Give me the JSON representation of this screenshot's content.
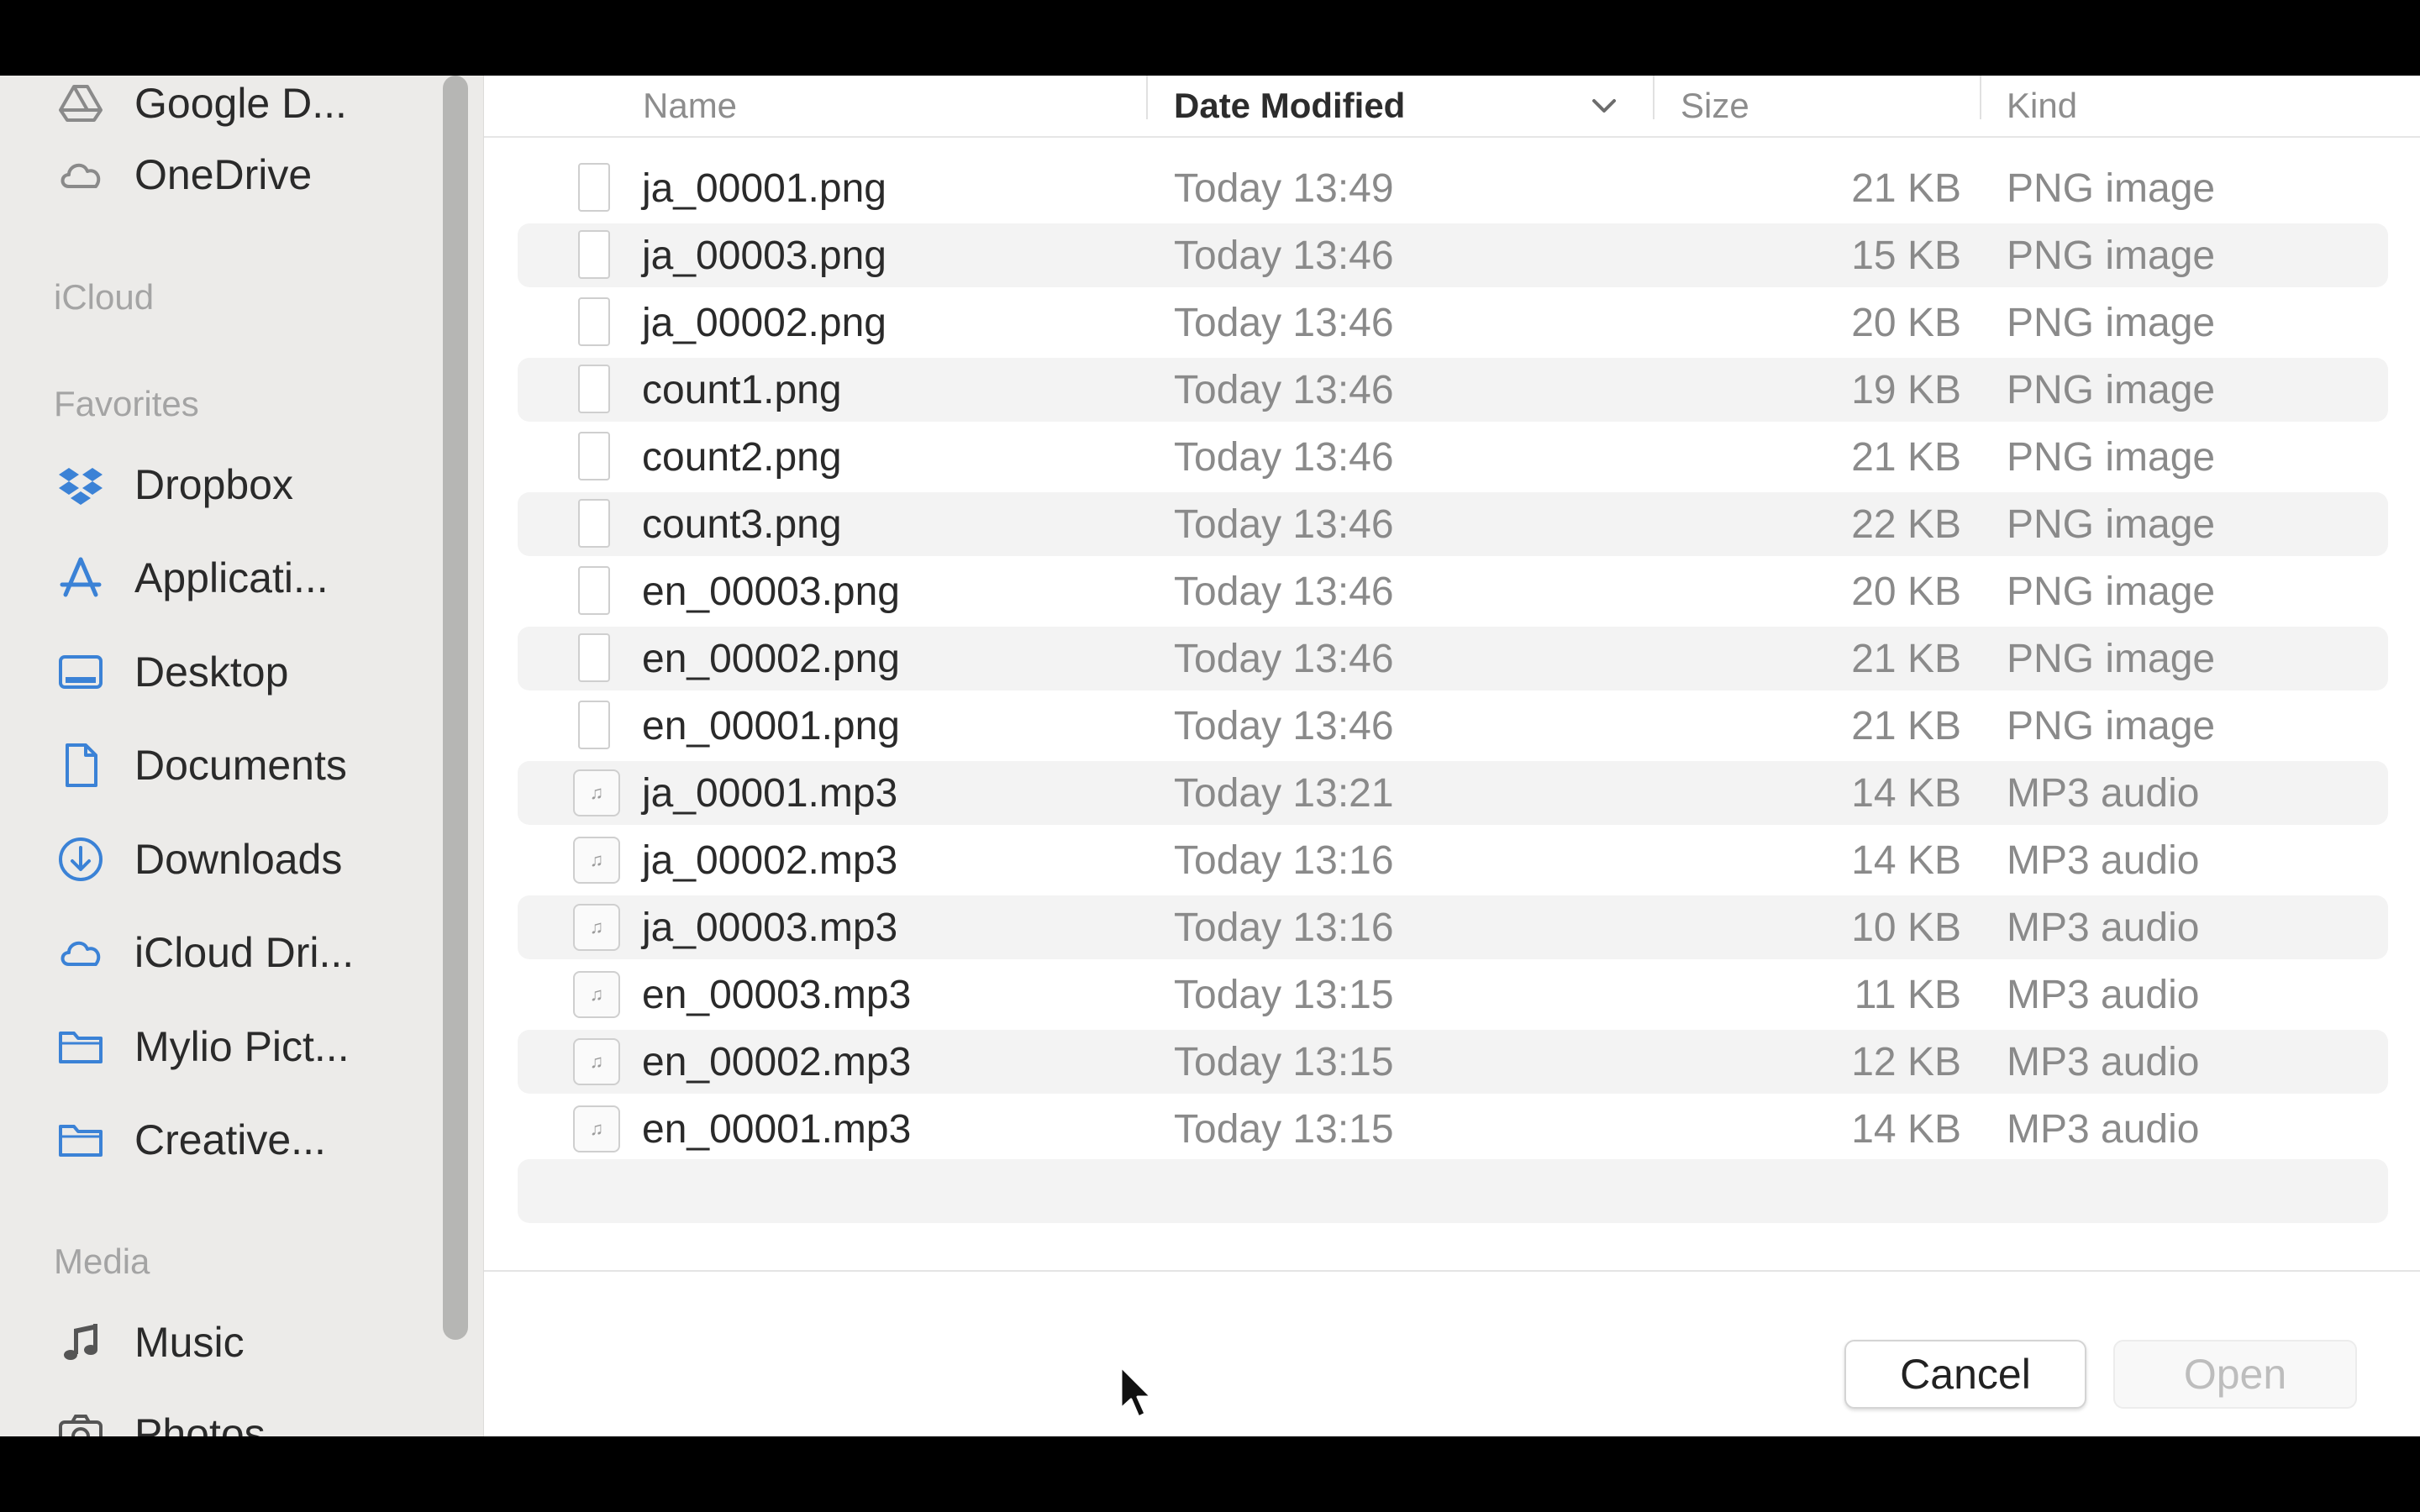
{
  "sidebar": {
    "top_items": [
      {
        "label": "Google D...",
        "icon": "google-drive-icon"
      },
      {
        "label": "OneDrive",
        "icon": "cloud-icon"
      }
    ],
    "sections": [
      {
        "label": "iCloud"
      },
      {
        "label": "Favorites"
      },
      {
        "label": "Media"
      }
    ],
    "favorites": [
      {
        "label": "Dropbox",
        "icon": "dropbox-icon"
      },
      {
        "label": "Applicati...",
        "icon": "applications-icon"
      },
      {
        "label": "Desktop",
        "icon": "desktop-icon"
      },
      {
        "label": "Documents",
        "icon": "document-icon"
      },
      {
        "label": "Downloads",
        "icon": "download-icon"
      },
      {
        "label": "iCloud Dri...",
        "icon": "cloud-icon"
      },
      {
        "label": "Mylio Pict...",
        "icon": "folder-icon"
      },
      {
        "label": "Creative...",
        "icon": "folder-icon"
      }
    ],
    "media": [
      {
        "label": "Music",
        "icon": "music-icon"
      },
      {
        "label": "Photos",
        "icon": "camera-icon"
      }
    ],
    "accent_color": "#3b82d6"
  },
  "header": {
    "name": "Name",
    "date_modified": "Date Modified",
    "size": "Size",
    "kind": "Kind"
  },
  "files": [
    {
      "name": "ja_00001.png",
      "date": "Today 13:49",
      "size": "21 KB",
      "kind": "PNG image",
      "type": "image"
    },
    {
      "name": "ja_00003.png",
      "date": "Today 13:46",
      "size": "15 KB",
      "kind": "PNG image",
      "type": "image"
    },
    {
      "name": "ja_00002.png",
      "date": "Today 13:46",
      "size": "20 KB",
      "kind": "PNG image",
      "type": "image"
    },
    {
      "name": "count1.png",
      "date": "Today 13:46",
      "size": "19 KB",
      "kind": "PNG image",
      "type": "image"
    },
    {
      "name": "count2.png",
      "date": "Today 13:46",
      "size": "21 KB",
      "kind": "PNG image",
      "type": "image"
    },
    {
      "name": "count3.png",
      "date": "Today 13:46",
      "size": "22 KB",
      "kind": "PNG image",
      "type": "image"
    },
    {
      "name": "en_00003.png",
      "date": "Today 13:46",
      "size": "20 KB",
      "kind": "PNG image",
      "type": "image"
    },
    {
      "name": "en_00002.png",
      "date": "Today 13:46",
      "size": "21 KB",
      "kind": "PNG image",
      "type": "image"
    },
    {
      "name": "en_00001.png",
      "date": "Today 13:46",
      "size": "21 KB",
      "kind": "PNG image",
      "type": "image"
    },
    {
      "name": "ja_00001.mp3",
      "date": "Today 13:21",
      "size": "14 KB",
      "kind": "MP3 audio",
      "type": "audio"
    },
    {
      "name": "ja_00002.mp3",
      "date": "Today 13:16",
      "size": "14 KB",
      "kind": "MP3 audio",
      "type": "audio"
    },
    {
      "name": "ja_00003.mp3",
      "date": "Today 13:16",
      "size": "10 KB",
      "kind": "MP3 audio",
      "type": "audio"
    },
    {
      "name": "en_00003.mp3",
      "date": "Today 13:15",
      "size": "11 KB",
      "kind": "MP3 audio",
      "type": "audio"
    },
    {
      "name": "en_00002.mp3",
      "date": "Today 13:15",
      "size": "12 KB",
      "kind": "MP3 audio",
      "type": "audio"
    },
    {
      "name": "en_00001.mp3",
      "date": "Today 13:15",
      "size": "14 KB",
      "kind": "MP3 audio",
      "type": "audio"
    }
  ],
  "buttons": {
    "cancel": "Cancel",
    "open": "Open"
  }
}
